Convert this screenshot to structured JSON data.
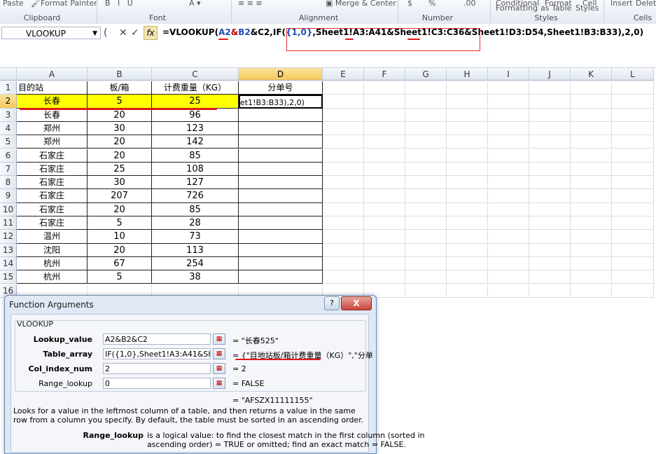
{
  "ribbon": {
    "top_items": [
      "Paste",
      "Format Painter",
      "Merge & Center",
      "$",
      "%",
      ".00",
      "Conditional",
      "Format",
      "Cell",
      "Insert",
      "Delete"
    ],
    "top_items_2": [
      "Formatting",
      "as Table",
      "Styles"
    ],
    "groups": [
      "Clipboard",
      "Font",
      "Alignment",
      "Number",
      "Styles",
      "Cells"
    ]
  },
  "formula_bar": {
    "name_box": "VLOOKUP",
    "cancel_glyph": "✕",
    "enter_glyph": "✓",
    "fx_label": "fx",
    "formula_parts": [
      "=VLOOKUP(",
      "A2",
      "&",
      "B2",
      "&C2,IF(",
      "{1,0}",
      ",",
      "Sheet1!A3:A41",
      "&",
      "Sheet1!C3:C36",
      "&",
      "Sheet1!D3:D54",
      ",",
      "Sheet1!B3:B33",
      "),2,0)"
    ]
  },
  "sheet": {
    "columns": [
      "A",
      "B",
      "C",
      "D",
      "E",
      "F",
      "G",
      "H",
      "I",
      "J",
      "K",
      "L"
    ],
    "rows": [
      "1",
      "2",
      "3",
      "4",
      "5",
      "6",
      "7",
      "8",
      "9",
      "10",
      "11",
      "12",
      "13",
      "14",
      "15",
      "16"
    ],
    "header_row": [
      "目的站",
      "板/箱",
      "计费重量（KG）",
      "分单号"
    ],
    "data": [
      [
        "长春",
        "5",
        "25",
        "et1!B3:B33),2,0)"
      ],
      [
        "长春",
        "20",
        "96",
        ""
      ],
      [
        "郑州",
        "30",
        "123",
        ""
      ],
      [
        "郑州",
        "20",
        "142",
        ""
      ],
      [
        "石家庄",
        "20",
        "85",
        ""
      ],
      [
        "石家庄",
        "25",
        "108",
        ""
      ],
      [
        "石家庄",
        "30",
        "127",
        ""
      ],
      [
        "石家庄",
        "207",
        "726",
        ""
      ],
      [
        "石家庄",
        "20",
        "85",
        ""
      ],
      [
        "石家庄",
        "5",
        "28",
        ""
      ],
      [
        "温州",
        "10",
        "73",
        ""
      ],
      [
        "沈阳",
        "20",
        "113",
        ""
      ],
      [
        "杭州",
        "67",
        "254",
        ""
      ],
      [
        "杭州",
        "5",
        "38",
        ""
      ]
    ],
    "highlight_color": "#ffff00"
  },
  "dialog": {
    "title": "Function Arguments",
    "help": "?",
    "close": "X",
    "function_name": "VLOOKUP",
    "args": [
      {
        "label": "Lookup_value",
        "value": "A2&B2&C2",
        "result": "=  \"长春525\""
      },
      {
        "label": "Table_array",
        "value": "IF({1,0},Sheet1!A3:A41&Sheet1!",
        "result": "=  {\"目地站板/箱计费重量（KG）\",\"分单"
      },
      {
        "label": "Col_index_num",
        "value": "2",
        "result": "=  2"
      },
      {
        "label": "Range_lookup",
        "value": "0",
        "result": "=  FALSE"
      }
    ],
    "overall_result": "=  \"AFSZX11111155\"",
    "description": "Looks for a value in the leftmost column of a table, and then returns a value in the same row from a column you specify. By default, the table must be sorted in an ascending order.",
    "arg_help_label": "Range_lookup",
    "arg_help_text_1": "is a logical value: to find the closest match in the first column (sorted in",
    "arg_help_text_2": "ascending order) = TRUE or omitted; find an exact match = FALSE."
  }
}
